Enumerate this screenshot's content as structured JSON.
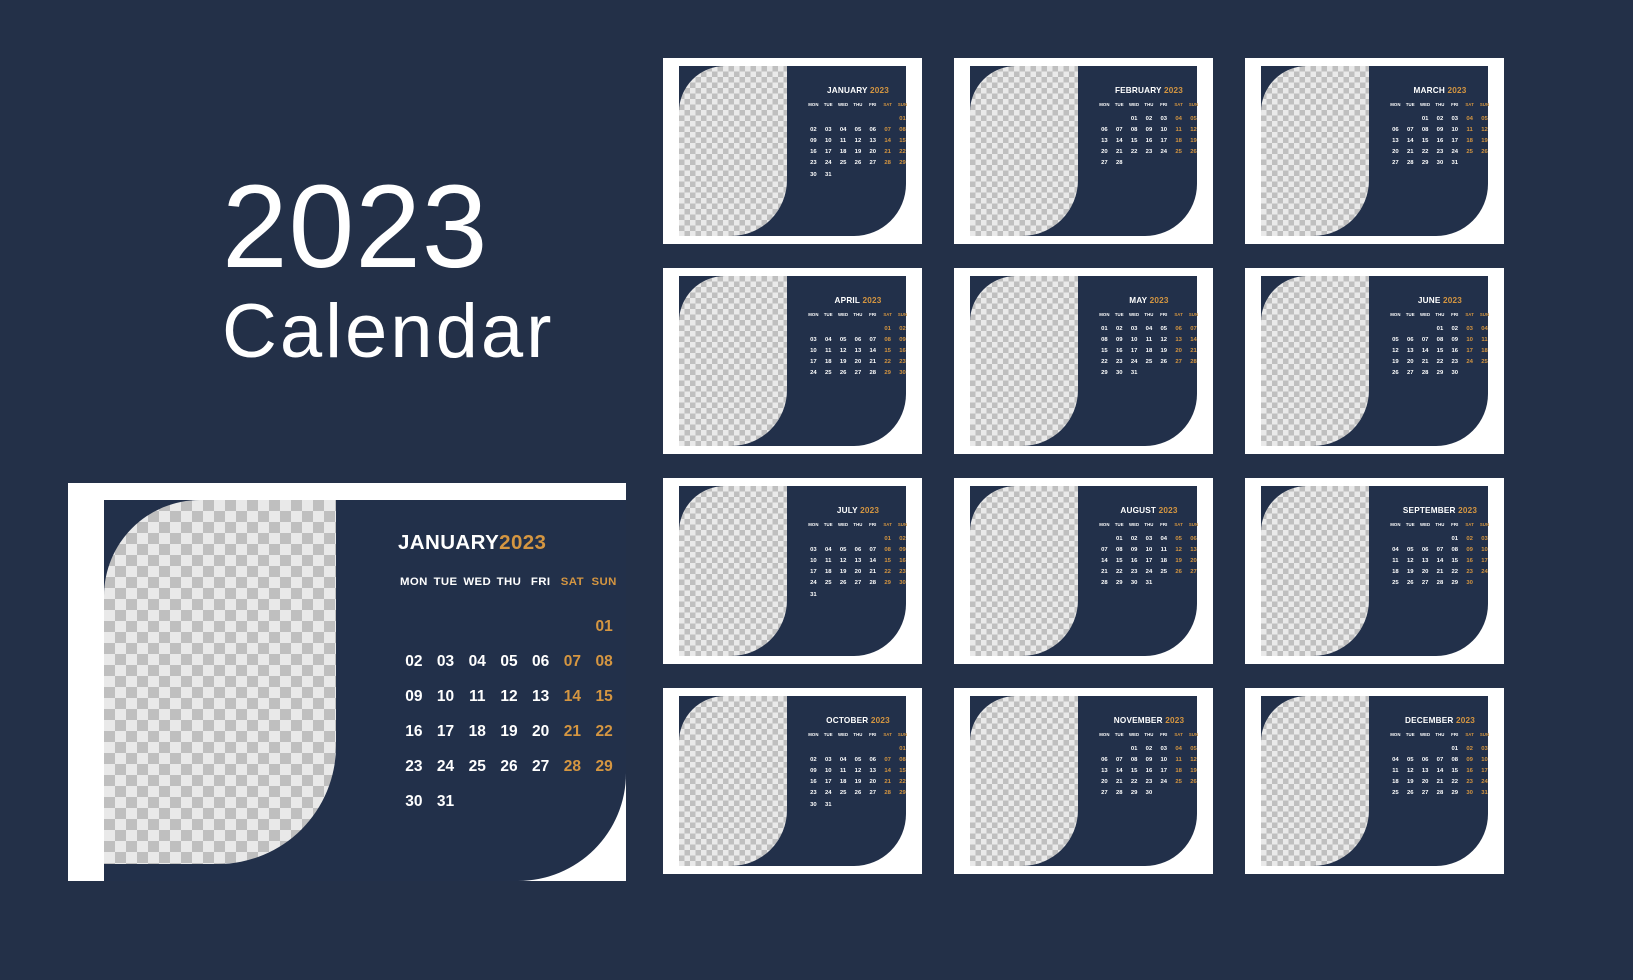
{
  "theme": {
    "page_background": "#233048",
    "card_background": "#ffffff",
    "panel_navy": "#22304a",
    "accent_orange": "#d59641",
    "text_white": "#ffffff",
    "placeholder_light": "#e9e9e9",
    "placeholder_dark": "#bfbfbf"
  },
  "title": {
    "year": "2023",
    "word": "Calendar"
  },
  "weekdays": [
    "MON",
    "TUE",
    "WED",
    "THU",
    "FRI",
    "SAT",
    "SUN"
  ],
  "weekend_indices": [
    5,
    6
  ],
  "feature": {
    "month": "JANUARY",
    "year": "2023",
    "start_weekday_index": 6,
    "days_in_month": 31,
    "image_placeholder": "checkerboard-transparency-placeholder"
  },
  "months": [
    {
      "month": "JANUARY",
      "year": "2023",
      "start_weekday_index": 6,
      "days_in_month": 31
    },
    {
      "month": "FEBRUARY",
      "year": "2023",
      "start_weekday_index": 2,
      "days_in_month": 28
    },
    {
      "month": "MARCH",
      "year": "2023",
      "start_weekday_index": 2,
      "days_in_month": 31
    },
    {
      "month": "APRIL",
      "year": "2023",
      "start_weekday_index": 5,
      "days_in_month": 30
    },
    {
      "month": "MAY",
      "year": "2023",
      "start_weekday_index": 0,
      "days_in_month": 31
    },
    {
      "month": "JUNE",
      "year": "2023",
      "start_weekday_index": 3,
      "days_in_month": 30
    },
    {
      "month": "JULY",
      "year": "2023",
      "start_weekday_index": 5,
      "days_in_month": 31
    },
    {
      "month": "AUGUST",
      "year": "2023",
      "start_weekday_index": 1,
      "days_in_month": 31
    },
    {
      "month": "SEPTEMBER",
      "year": "2023",
      "start_weekday_index": 4,
      "days_in_month": 30
    },
    {
      "month": "OCTOBER",
      "year": "2023",
      "start_weekday_index": 6,
      "days_in_month": 31
    },
    {
      "month": "NOVEMBER",
      "year": "2023",
      "start_weekday_index": 2,
      "days_in_month": 30
    },
    {
      "month": "DECEMBER",
      "year": "2023",
      "start_weekday_index": 4,
      "days_in_month": 31
    }
  ]
}
